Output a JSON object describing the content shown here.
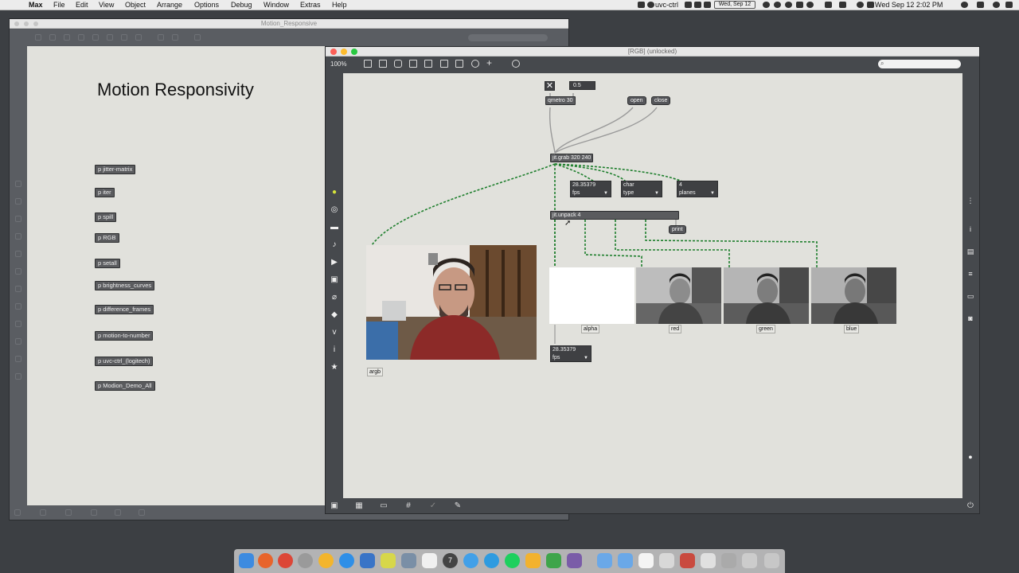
{
  "menubar": {
    "app_name": "Max",
    "menus": [
      "File",
      "Edit",
      "View",
      "Object",
      "Arrange",
      "Options",
      "Debug",
      "Window",
      "Extras",
      "Help"
    ],
    "status_text": "uvc-ctrl",
    "date_box": "Wed, Sep 12",
    "clock": "Wed Sep 12  2:02 PM"
  },
  "bg_window": {
    "title": "Motion_Responsive",
    "heading": "Motion Responsivity",
    "subpatchers": [
      "p jitter-matrix",
      "p iter",
      "p spill",
      "p RGB",
      "p setall",
      "p brightness_curves",
      "p difference_frames",
      "p motion-to-number",
      "p uvc-ctrl_(logitech)",
      "p Modion_Demo_All"
    ]
  },
  "front_window": {
    "title": "[RGB] (unlocked)",
    "zoom": "100%",
    "patch": {
      "toggle_symbol": "✕",
      "float_value": "0.5",
      "qmetro": "qmetro 30",
      "open_msg": "open",
      "close_msg": "close",
      "jitgrab": "jit.grab 320 240",
      "fps_attr": {
        "value": "28.35379",
        "name": "fps"
      },
      "type_attr": {
        "value": "char",
        "name": "type"
      },
      "planes_attr": {
        "value": "4",
        "name": "planes"
      },
      "unpack": "jit.unpack 4",
      "print": "print",
      "fps_attr2": {
        "value": "28.35379",
        "name": "fps"
      },
      "labels": {
        "argb": "argb",
        "alpha": "alpha",
        "red": "red",
        "green": "green",
        "blue": "blue"
      }
    }
  },
  "dock_icons": [
    "finder",
    "firefox",
    "chrome",
    "safari",
    "max",
    "safari-compass",
    "textwrangler",
    "finder-2",
    "numbers",
    "notes",
    "max7",
    "messages",
    "skype",
    "spotify",
    "lightbulb",
    "evernote",
    "screens",
    "folder",
    "folder",
    "document",
    "window",
    "window",
    "window",
    "window",
    "window",
    "trash"
  ]
}
